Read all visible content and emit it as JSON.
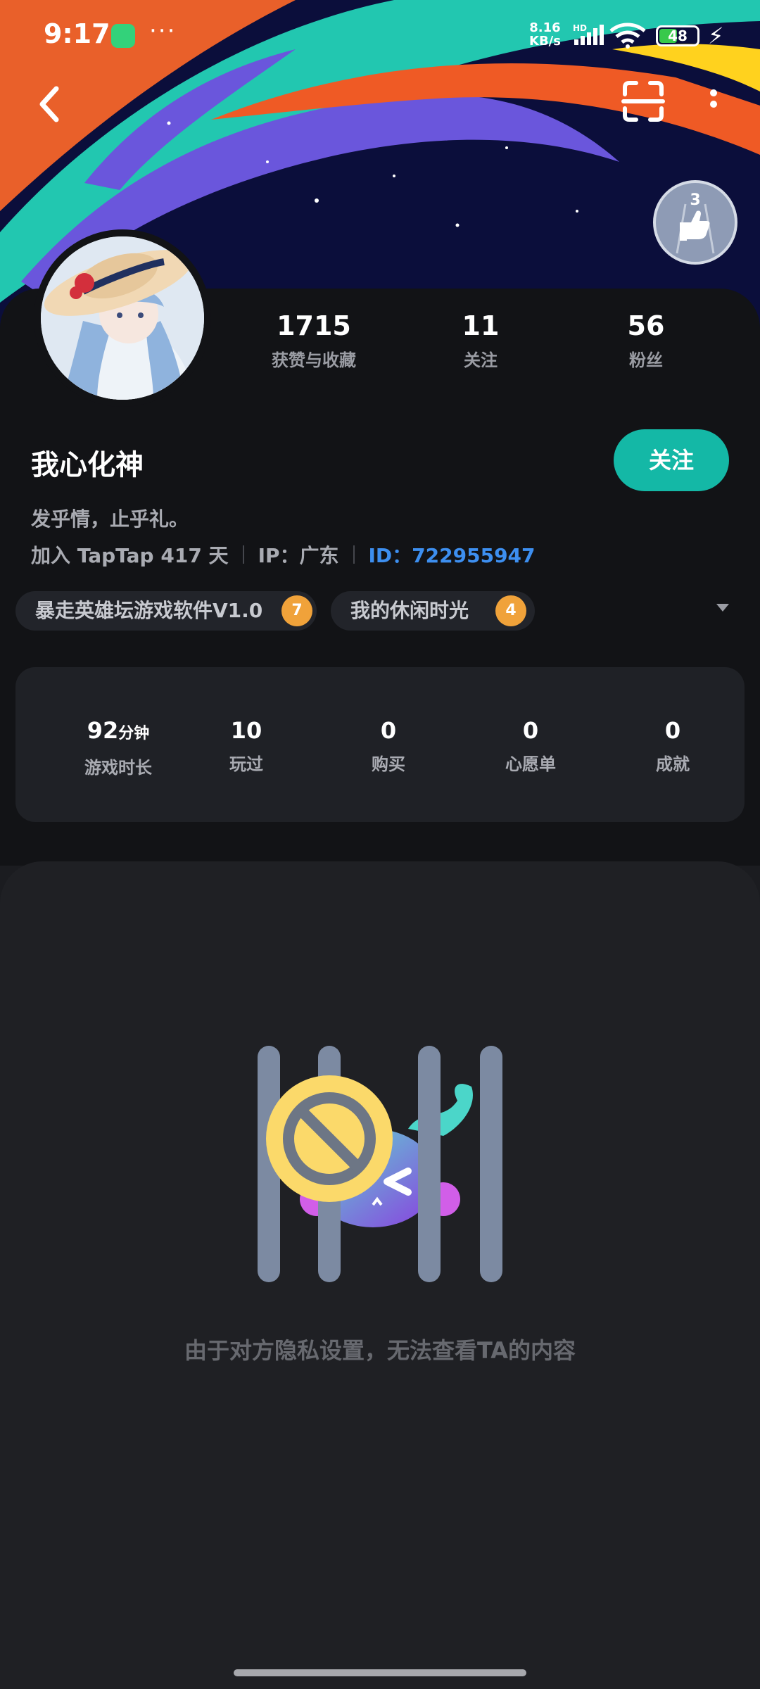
{
  "status_bar": {
    "time": "9:17",
    "more": "···",
    "net_speed_value": "8.16",
    "net_speed_unit": "KB/s",
    "network_badge": "HD",
    "battery_level": 48,
    "battery_text": "48"
  },
  "badge": {
    "level": "3"
  },
  "profile": {
    "stats": [
      {
        "value": "1715",
        "label": "获赞与收藏"
      },
      {
        "value": "11",
        "label": "关注"
      },
      {
        "value": "56",
        "label": "粉丝"
      }
    ],
    "username": "我心化神",
    "follow_label": "关注",
    "bio": "发乎情，止乎礼。",
    "join_text": "加入 TapTap 417 天",
    "ip_text": "IP：广东",
    "id_text": "ID：722955947",
    "tags": [
      {
        "label": "暴走英雄坛游戏软件V1.0",
        "level": "7"
      },
      {
        "label": "我的休闲时光",
        "level": "4"
      }
    ]
  },
  "game_stats": [
    {
      "value": "92",
      "unit": "分钟",
      "label": "游戏时长"
    },
    {
      "value": "10",
      "unit": "",
      "label": "玩过"
    },
    {
      "value": "0",
      "unit": "",
      "label": "购买"
    },
    {
      "value": "0",
      "unit": "",
      "label": "心愿单"
    },
    {
      "value": "0",
      "unit": "",
      "label": "成就"
    }
  ],
  "empty_state": {
    "message": "由于对方隐私设置，无法查看TA的内容"
  },
  "icons": {
    "back": "chevron-left-icon",
    "scan": "scan-icon",
    "menu": "more-vertical-icon",
    "badge": "thumbs-up-badge-icon",
    "dropdown": "chevron-down-icon",
    "empty": "blocked-cage-icon"
  },
  "colors": {
    "accent": "#14b8a6",
    "link": "#3d8ff0",
    "background": "#1b1c20",
    "battery": "#38c94b"
  }
}
